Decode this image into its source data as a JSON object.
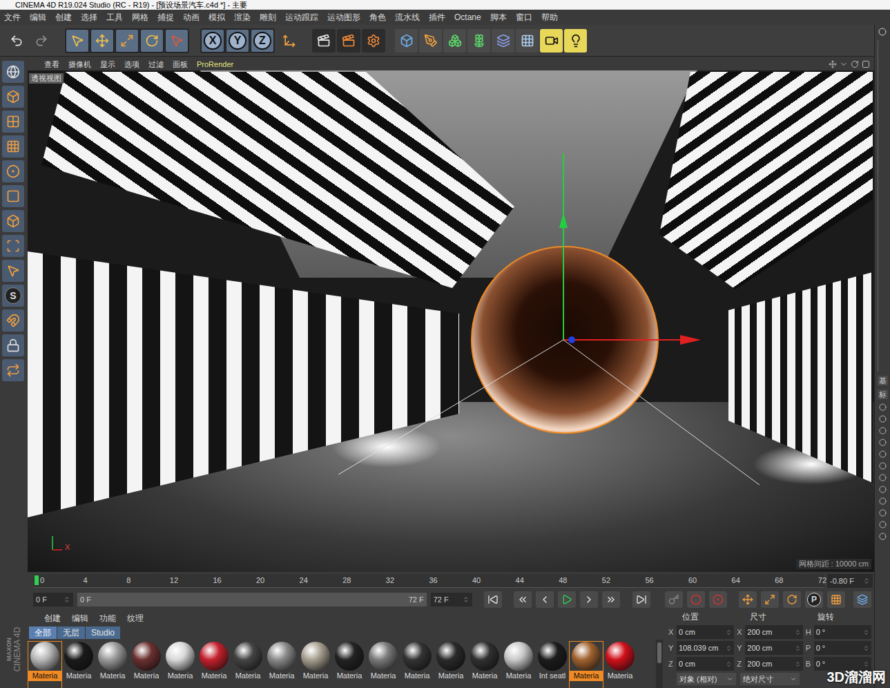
{
  "window": {
    "title": "CINEMA 4D R19.024 Studio (RC - R19) - [预设场景汽车.c4d *] - 主要"
  },
  "menu": [
    "文件",
    "编辑",
    "创建",
    "选择",
    "工具",
    "网格",
    "捕捉",
    "动画",
    "模拟",
    "渲染",
    "雕刻",
    "运动跟踪",
    "运动图形",
    "角色",
    "流水线",
    "插件",
    "Octane",
    "脚本",
    "窗口",
    "帮助"
  ],
  "toolbar": {
    "axes": [
      "X",
      "Y",
      "Z"
    ]
  },
  "left_toolbar": {
    "snap_label": "S"
  },
  "viewport": {
    "menu": [
      "查看",
      "摄像机",
      "显示",
      "选项",
      "过滤",
      "面板",
      "ProRender"
    ],
    "label": "透视视图",
    "grid_spacing": "网格间距 : 10000 cm",
    "axis_label": "X"
  },
  "timeline": {
    "ticks": [
      {
        "label": "0",
        "selected": true
      },
      {
        "label": "4",
        "selected": false
      },
      {
        "label": "8",
        "selected": false
      },
      {
        "label": "12",
        "selected": false
      },
      {
        "label": "16",
        "selected": false
      },
      {
        "label": "20",
        "selected": false
      },
      {
        "label": "24",
        "selected": false
      },
      {
        "label": "28",
        "selected": false
      },
      {
        "label": "32",
        "selected": false
      },
      {
        "label": "36",
        "selected": false
      },
      {
        "label": "40",
        "selected": false
      },
      {
        "label": "44",
        "selected": false
      },
      {
        "label": "48",
        "selected": false
      },
      {
        "label": "52",
        "selected": false
      },
      {
        "label": "56",
        "selected": false
      },
      {
        "label": "60",
        "selected": false
      },
      {
        "label": "64",
        "selected": false
      },
      {
        "label": "68",
        "selected": false
      },
      {
        "label": "72",
        "selected": false
      }
    ],
    "field": "-0.80 F"
  },
  "playback": {
    "start_field": "0 F",
    "range_start": "0 F",
    "range_end": "72 F",
    "end_field": "72 F",
    "mode_button": "P"
  },
  "materials": {
    "menu": [
      "创建",
      "编辑",
      "功能",
      "纹理"
    ],
    "filters": [
      {
        "label": "全部",
        "selected": true
      },
      {
        "label": "无层",
        "selected": false
      },
      {
        "label": "Studio",
        "selected": false
      }
    ],
    "items": [
      {
        "label": "Materia",
        "selected": true,
        "color": "#b8b8b8"
      },
      {
        "label": "Materia",
        "selected": false,
        "color": "#1a1a1a"
      },
      {
        "label": "Materia",
        "selected": false,
        "color": "#9a9a9a"
      },
      {
        "label": "Materia",
        "selected": false,
        "color": "#6b3030"
      },
      {
        "label": "Materia",
        "selected": false,
        "color": "#d8d8d8"
      },
      {
        "label": "Materia",
        "selected": false,
        "color": "#c4202c"
      },
      {
        "label": "Materia",
        "selected": false,
        "color": "#444444"
      },
      {
        "label": "Materia",
        "selected": false,
        "color": "#8a8a8a"
      },
      {
        "label": "Materia",
        "selected": false,
        "color": "#a79f90"
      },
      {
        "label": "Materia",
        "selected": false,
        "color": "#222222"
      },
      {
        "label": "Materia",
        "selected": false,
        "color": "#7a7a7a"
      },
      {
        "label": "Materia",
        "selected": false,
        "color": "#333333"
      },
      {
        "label": "Materia",
        "selected": false,
        "color": "#2a2a2a"
      },
      {
        "label": "Materia",
        "selected": false,
        "color": "#303030"
      },
      {
        "label": "Materia",
        "selected": false,
        "color": "#c8c8c8"
      },
      {
        "label": "Int seatl",
        "selected": false,
        "color": "#1c1c1c"
      },
      {
        "label": "Materia",
        "selected": true,
        "color": "#a0622e"
      },
      {
        "label": "Materia",
        "selected": false,
        "color": "#d0101a"
      }
    ]
  },
  "coordinates": {
    "headers": [
      "位置",
      "尺寸",
      "旋转"
    ],
    "rows": [
      {
        "pos_axis": "X",
        "pos": "0 cm",
        "size_axis": "X",
        "size": "200 cm",
        "rot_axis": "H",
        "rot": "0 °"
      },
      {
        "pos_axis": "Y",
        "pos": "108.039 cm",
        "size_axis": "Y",
        "size": "200 cm",
        "rot_axis": "P",
        "rot": "0 °"
      },
      {
        "pos_axis": "Z",
        "pos": "0 cm",
        "size_axis": "Z",
        "size": "200 cm",
        "rot_axis": "B",
        "rot": "0 °"
      }
    ],
    "modes": [
      "对象 (相对)",
      "绝对尺寸"
    ]
  },
  "side_panel": {
    "tabs": [
      "基",
      "标"
    ]
  },
  "logo": [
    "MAXON",
    "CINEMA 4D"
  ],
  "watermark": "3D溜溜网"
}
